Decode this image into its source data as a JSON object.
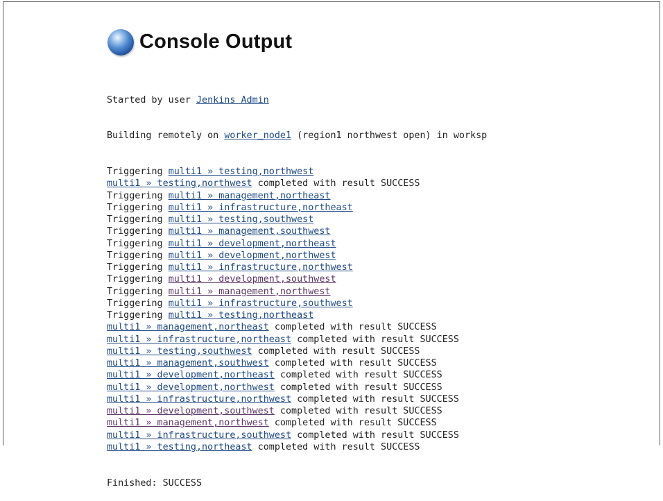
{
  "page": {
    "title": "Console Output"
  },
  "console": {
    "started": {
      "prefix": "Started by user ",
      "user_link": "Jenkins Admin"
    },
    "building": {
      "prefix": "Building remotely on ",
      "node_link": "worker_node1",
      "suffix": " (region1 northwest open) in worksp"
    },
    "trigger_prefix": "Triggering ",
    "completed_suffix": " completed with result SUCCESS",
    "lines": [
      {
        "kind": "trigger",
        "link": "multi1 » testing,northwest",
        "visited": false
      },
      {
        "kind": "completed",
        "link": "multi1 » testing,northwest",
        "visited": false
      },
      {
        "kind": "trigger",
        "link": "multi1 » management,northeast",
        "visited": false
      },
      {
        "kind": "trigger",
        "link": "multi1 » infrastructure,northeast",
        "visited": false
      },
      {
        "kind": "trigger",
        "link": "multi1 » testing,southwest",
        "visited": false
      },
      {
        "kind": "trigger",
        "link": "multi1 » management,southwest",
        "visited": false
      },
      {
        "kind": "trigger",
        "link": "multi1 » development,northeast",
        "visited": false
      },
      {
        "kind": "trigger",
        "link": "multi1 » development,northwest",
        "visited": false
      },
      {
        "kind": "trigger",
        "link": "multi1 » infrastructure,northwest",
        "visited": false
      },
      {
        "kind": "trigger",
        "link": "multi1 » development,southwest",
        "visited": true
      },
      {
        "kind": "trigger",
        "link": "multi1 » management,northwest",
        "visited": true
      },
      {
        "kind": "trigger",
        "link": "multi1 » infrastructure,southwest",
        "visited": false
      },
      {
        "kind": "trigger",
        "link": "multi1 » testing,northeast",
        "visited": false
      },
      {
        "kind": "completed",
        "link": "multi1 » management,northeast",
        "visited": false
      },
      {
        "kind": "completed",
        "link": "multi1 » infrastructure,northeast",
        "visited": false
      },
      {
        "kind": "completed",
        "link": "multi1 » testing,southwest",
        "visited": false
      },
      {
        "kind": "completed",
        "link": "multi1 » management,southwest",
        "visited": false
      },
      {
        "kind": "completed",
        "link": "multi1 » development,northeast",
        "visited": false
      },
      {
        "kind": "completed",
        "link": "multi1 » development,northwest",
        "visited": false
      },
      {
        "kind": "completed",
        "link": "multi1 » infrastructure,northwest",
        "visited": false
      },
      {
        "kind": "completed",
        "link": "multi1 » development,southwest",
        "visited": true
      },
      {
        "kind": "completed",
        "link": "multi1 » management,northwest",
        "visited": true
      },
      {
        "kind": "completed",
        "link": "multi1 » infrastructure,southwest",
        "visited": false
      },
      {
        "kind": "completed",
        "link": "multi1 » testing,northeast",
        "visited": false
      }
    ],
    "finished": "Finished: SUCCESS"
  },
  "colors": {
    "link": "#204a87",
    "visited_link": "#5c3566",
    "text": "#222222"
  },
  "icons": {
    "header_icon": "blue-ball-icon"
  }
}
